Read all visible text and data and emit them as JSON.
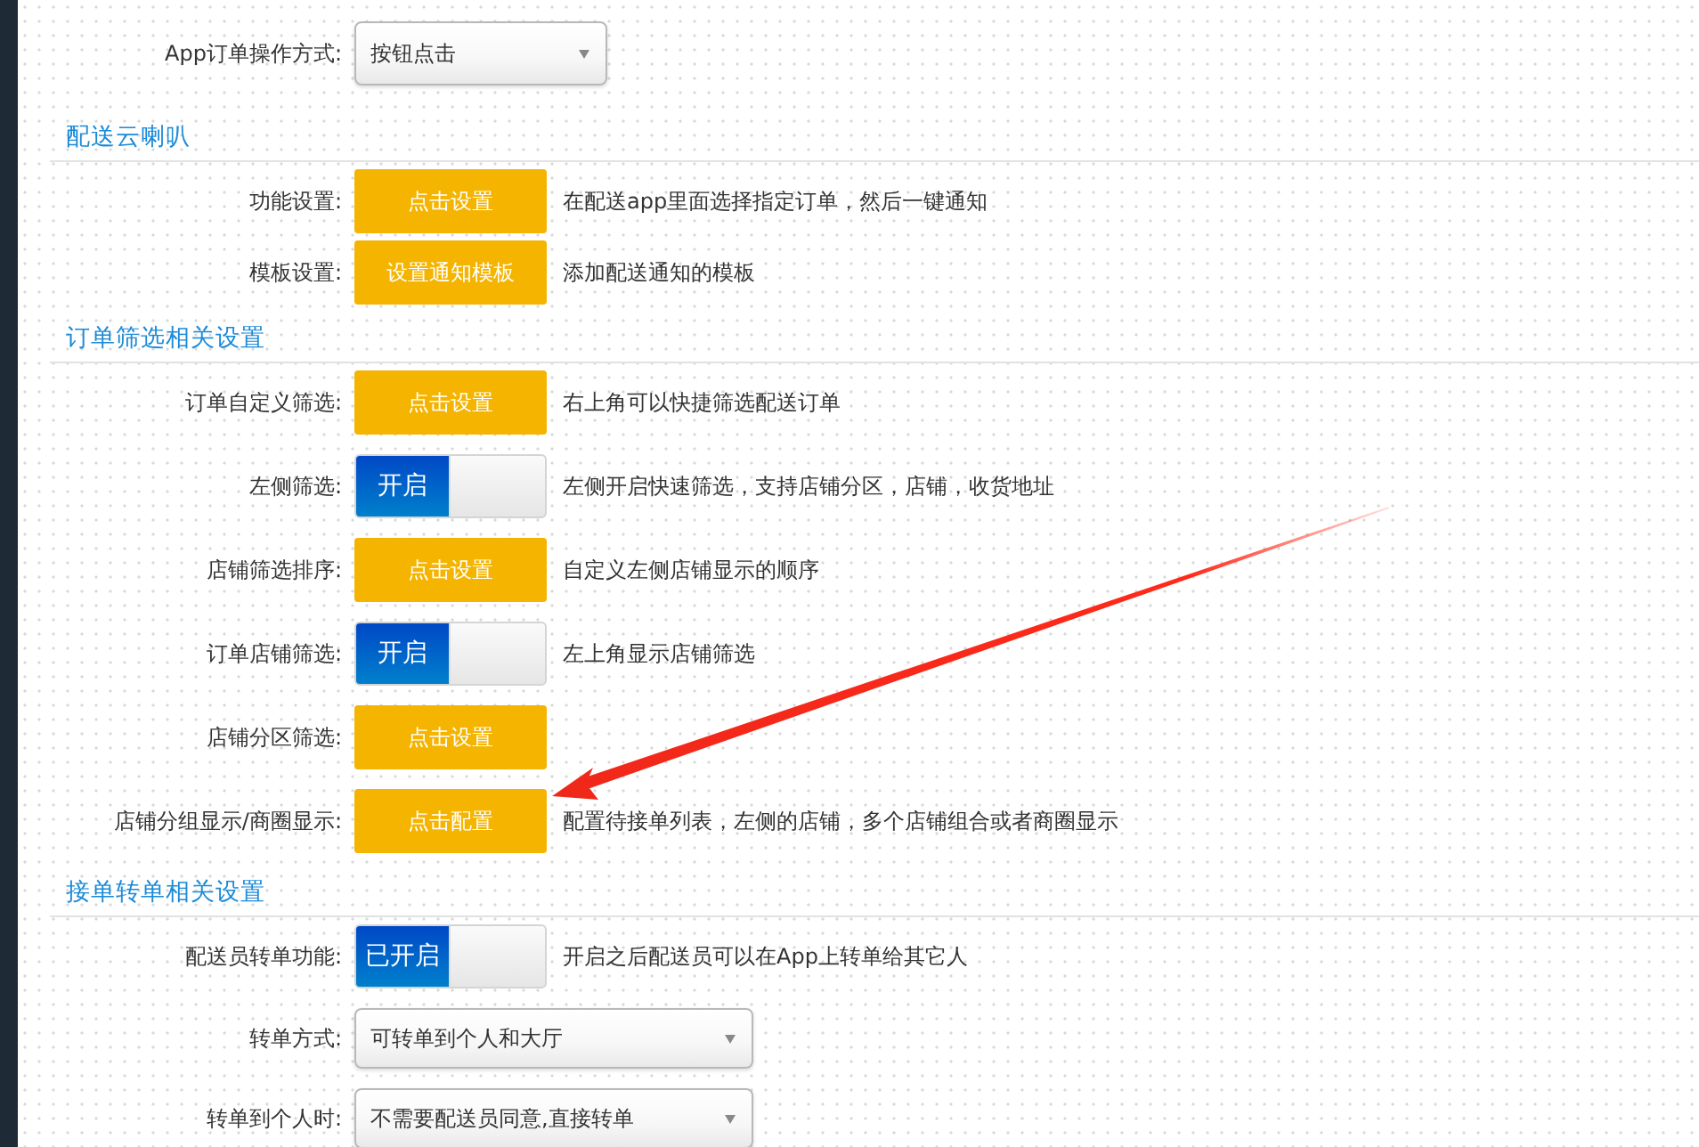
{
  "top_field": {
    "label": "App订单操作方式:",
    "value": "按钮点击"
  },
  "sections": [
    {
      "title": "配送云喇叭",
      "rows": [
        {
          "kind": "button",
          "label": "功能设置:",
          "button": "点击设置",
          "description": "在配送app里面选择指定订单，然后一键通知"
        },
        {
          "kind": "button",
          "label": "模板设置:",
          "button": "设置通知模板",
          "description": "添加配送通知的模板"
        }
      ]
    },
    {
      "title": "订单筛选相关设置",
      "rows": [
        {
          "kind": "button",
          "label": "订单自定义筛选:",
          "button": "点击设置",
          "description": "右上角可以快捷筛选配送订单"
        },
        {
          "kind": "toggle",
          "label": "左侧筛选:",
          "toggle": "开启",
          "on": true,
          "description": "左侧开启快速筛选，支持店铺分区，店铺，收货地址"
        },
        {
          "kind": "button",
          "label": "店铺筛选排序:",
          "button": "点击设置",
          "description": "自定义左侧店铺显示的顺序"
        },
        {
          "kind": "toggle",
          "label": "订单店铺筛选:",
          "toggle": "开启",
          "on": true,
          "description": "左上角显示店铺筛选"
        },
        {
          "kind": "button",
          "label": "店铺分区筛选:",
          "button": "点击设置"
        },
        {
          "kind": "button",
          "label": "店铺分组显示/商圈显示:",
          "button": "点击配置",
          "description": "配置待接单列表，左侧的店铺，多个店铺组合或者商圈显示"
        }
      ]
    },
    {
      "title": "接单转单相关设置",
      "rows": [
        {
          "kind": "toggle",
          "label": "配送员转单功能:",
          "toggle": "已开启",
          "on": true,
          "description": "开启之后配送员可以在App上转单给其它人"
        },
        {
          "kind": "select",
          "label": "转单方式:",
          "value": "可转单到个人和大厅"
        },
        {
          "kind": "select",
          "label": "转单到个人时:",
          "value": "不需要配送员同意,直接转单"
        }
      ]
    }
  ]
}
